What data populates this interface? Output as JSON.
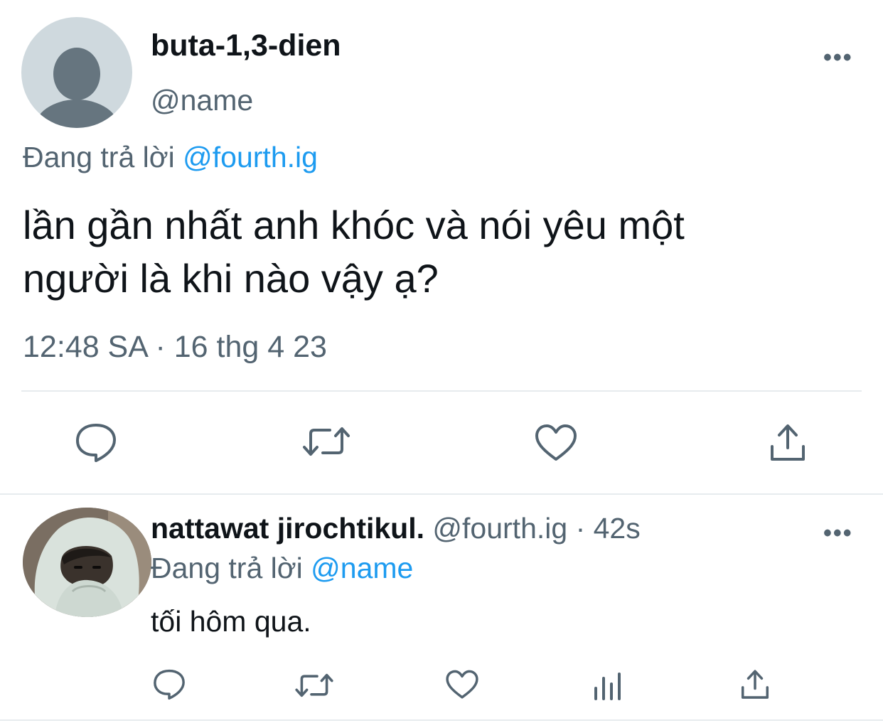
{
  "main_tweet": {
    "display_name": "buta-1,3-dien",
    "handle": "@name",
    "reply_prefix": "Đang trả lời",
    "reply_to": "@fourth.ig",
    "text_line1": "lần gần nhất anh khóc và nói yêu một",
    "text_line2": "người là khi nào vậy ạ?",
    "timestamp": "12:48 SA · 16 thg 4 23",
    "more": "•••",
    "actions": [
      "reply-icon",
      "retweet-icon",
      "like-icon",
      "share-icon"
    ]
  },
  "reply_tweet": {
    "display_name": "nattawat jirochtikul.",
    "handle": "@fourth.ig",
    "separator": " · ",
    "time": "42s",
    "reply_prefix": "Đang trả lời",
    "reply_to": "@name",
    "text": "tối hôm qua.",
    "more": "•••",
    "actions": [
      "reply-icon",
      "retweet-icon",
      "like-icon",
      "analytics-icon",
      "share-icon"
    ]
  },
  "colors": {
    "text": "#0f1419",
    "secondary": "#536471",
    "link": "#1d9bf0",
    "divider": "#e7ebee",
    "avatar_placeholder_bg": "#cfd9de"
  }
}
